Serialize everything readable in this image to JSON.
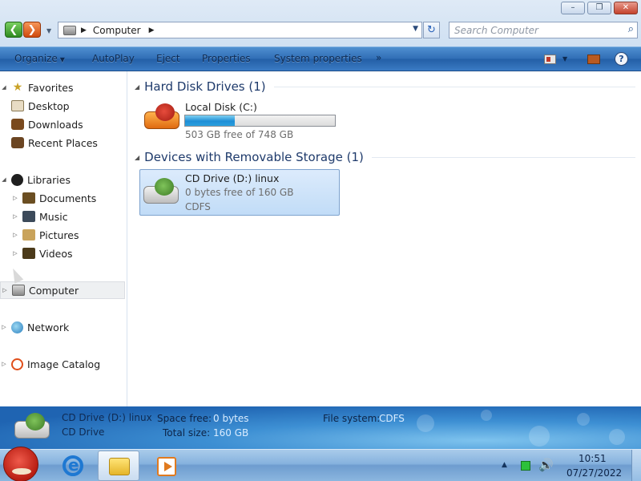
{
  "window": {
    "buttons": {
      "minimize": "–",
      "maximize": "❐",
      "close": "✕"
    }
  },
  "address": {
    "path": "Computer",
    "search_placeholder": "Search Computer"
  },
  "commands": [
    "Organize",
    "AutoPlay",
    "Eject",
    "Properties",
    "System properties"
  ],
  "commands_more": "»",
  "nav": {
    "favorites": {
      "label": "Favorites",
      "items": [
        "Desktop",
        "Downloads",
        "Recent Places"
      ]
    },
    "libraries": {
      "label": "Libraries",
      "items": [
        "Documents",
        "Music",
        "Pictures",
        "Videos"
      ]
    },
    "computer": "Computer",
    "network": "Network",
    "image_catalog": "Image Catalog"
  },
  "groups": {
    "hard_disks": {
      "title": "Hard Disk Drives (1)",
      "drive": {
        "name": "Local Disk (C:)",
        "free_text": "503 GB free of 748 GB",
        "used_fraction": 0.33
      }
    },
    "removable": {
      "title": "Devices with Removable Storage (1)",
      "drive": {
        "name": "CD Drive (D:) linux",
        "free_text": "0 bytes free of 160 GB",
        "filesystem": "CDFS"
      }
    }
  },
  "details": {
    "name": "CD Drive (D:) linux",
    "type": "CD Drive",
    "space_free_label": "Space free:",
    "space_free_value": "0 bytes",
    "total_size_label": "Total size:",
    "total_size_value": "160 GB",
    "filesystem_label": "File system:",
    "filesystem_value": "CDFS"
  },
  "taskbar": {
    "time": "10:51",
    "date": "07/27/2022"
  },
  "colors": {
    "command_bar": "#3a7bc4",
    "selection": "#c1dcf7",
    "progress": "#1e8ed6"
  }
}
